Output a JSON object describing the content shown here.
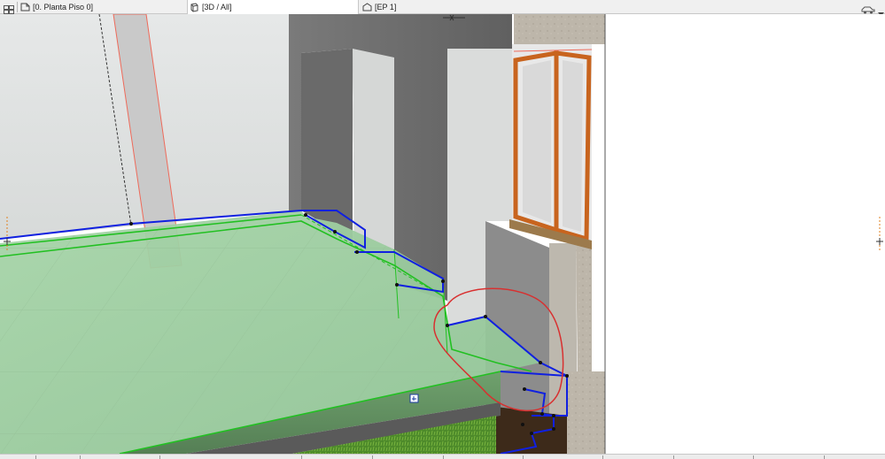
{
  "tabs": [
    {
      "label": "[0. Planta Piso 0]",
      "icon": "floor-plan-icon"
    },
    {
      "label": "[3D / All]",
      "icon": "3d-view-icon"
    },
    {
      "label": "[EP 1]",
      "icon": "elevation-icon"
    }
  ],
  "toolbar_icons": [
    "tab-grid-icon",
    "car-icon",
    "dropdown-arrow-icon"
  ],
  "viewport": {
    "description_icons": [
      "section-marker-icon",
      "selection-handle-icon",
      "level-marker-icon"
    ],
    "colors": {
      "selection_blue": "#1020e0",
      "slab_green": "#22c022",
      "markup_red": "#d83030",
      "window_frame": "#c8641e",
      "wall_grey": "#6f6f6f",
      "wall_light": "#dcdcdc",
      "section_cut": "#b8b0a4",
      "grass": "#4a8a2a"
    }
  }
}
